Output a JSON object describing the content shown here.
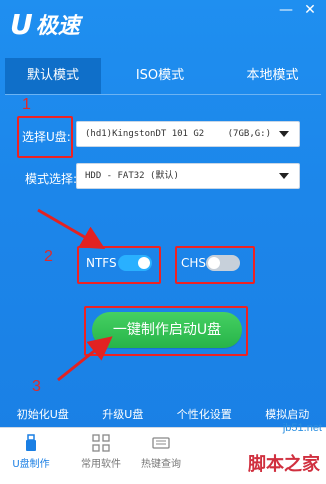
{
  "app": {
    "logo_u": "U",
    "logo_text": "极速",
    "window_controls": [
      "minimize-icon",
      "close-icon"
    ]
  },
  "tabs": [
    {
      "label": "默认模式",
      "active": true
    },
    {
      "label": "ISO模式",
      "active": false
    },
    {
      "label": "本地模式",
      "active": false
    }
  ],
  "annotations": {
    "n1": "1",
    "n2": "2",
    "n3": "3",
    "color": "#e22222"
  },
  "usb": {
    "label": "选择U盘:",
    "value": "(hd1)KingstonDT 101 G2",
    "capacity": "(7GB,G:)"
  },
  "mode": {
    "label": "模式选择:",
    "value": "HDD - FAT32 (默认)"
  },
  "toggles": {
    "ntfs_label": "NTFS",
    "ntfs_on": true,
    "chs_label": "CHS",
    "chs_on": false
  },
  "main_button": "一键制作启动U盘",
  "bottom_links": [
    "初始化U盘",
    "升级U盘",
    "个性化设置",
    "模拟启动"
  ],
  "footer": [
    {
      "label": "U盘制作",
      "icon": "usb-icon",
      "active": true
    },
    {
      "label": "常用软件",
      "icon": "grid-icon",
      "active": false
    },
    {
      "label": "热键查询",
      "icon": "keyboard-icon",
      "active": false
    }
  ],
  "watermark": {
    "site": "jb51.net",
    "text": "脚本之家"
  },
  "colors": {
    "background": "#1c86ea",
    "accent_green": "#2fbe52",
    "toggle_on": "#29b0ff"
  }
}
